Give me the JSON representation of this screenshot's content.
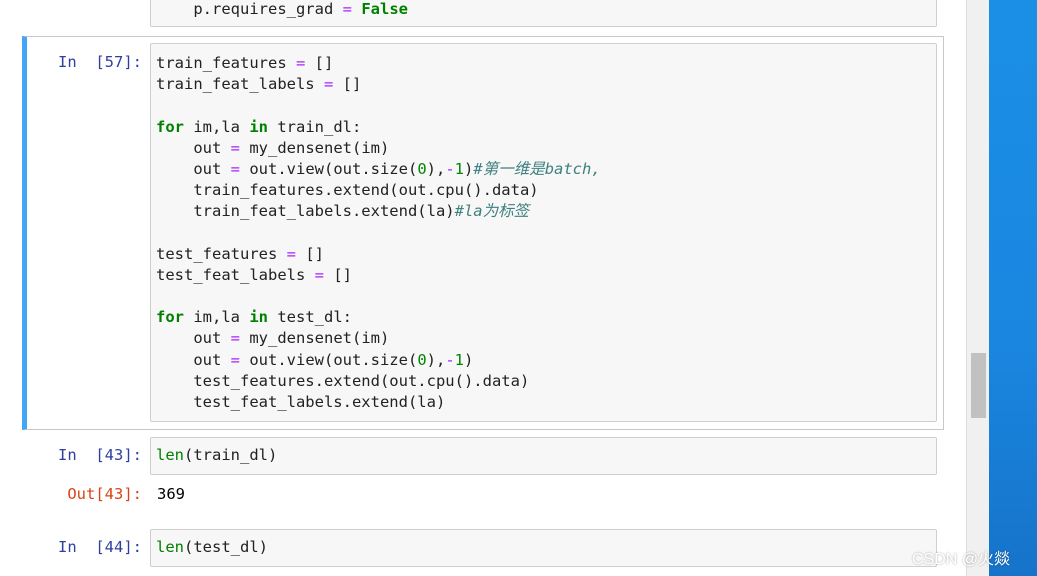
{
  "cells": {
    "prev": {
      "line": "    p.requires_grad = False"
    },
    "c57": {
      "prompt": "In  [57]:",
      "lines": [
        "train_features = []",
        "train_feat_labels = []",
        "",
        "for im,la in train_dl:",
        "    out = my_densenet(im)",
        "    out = out.view(out.size(0),-1)#第一维是batch,",
        "    train_features.extend(out.cpu().data)",
        "    train_feat_labels.extend(la)#la为标签",
        "",
        "test_features = []",
        "test_feat_labels = []",
        "",
        "for im,la in test_dl:",
        "    out = my_densenet(im)",
        "    out = out.view(out.size(0),-1)",
        "    test_features.extend(out.cpu().data)",
        "    test_feat_labels.extend(la)"
      ]
    },
    "c43": {
      "prompt": "In  [43]:",
      "code": "len(train_dl)",
      "out_prompt": "Out[43]:",
      "output": "369"
    },
    "c44": {
      "prompt": "In  [44]:",
      "code": "len(test_dl)"
    }
  },
  "watermark": "CSDN @火燚",
  "colors": {
    "selected_border": "#42a5f5",
    "in_prompt": "#303f9f",
    "out_prompt": "#d84315",
    "keyword": "#008000",
    "operator": "#aa22ff",
    "comment": "#408080",
    "desktop": "#1a86e0"
  }
}
